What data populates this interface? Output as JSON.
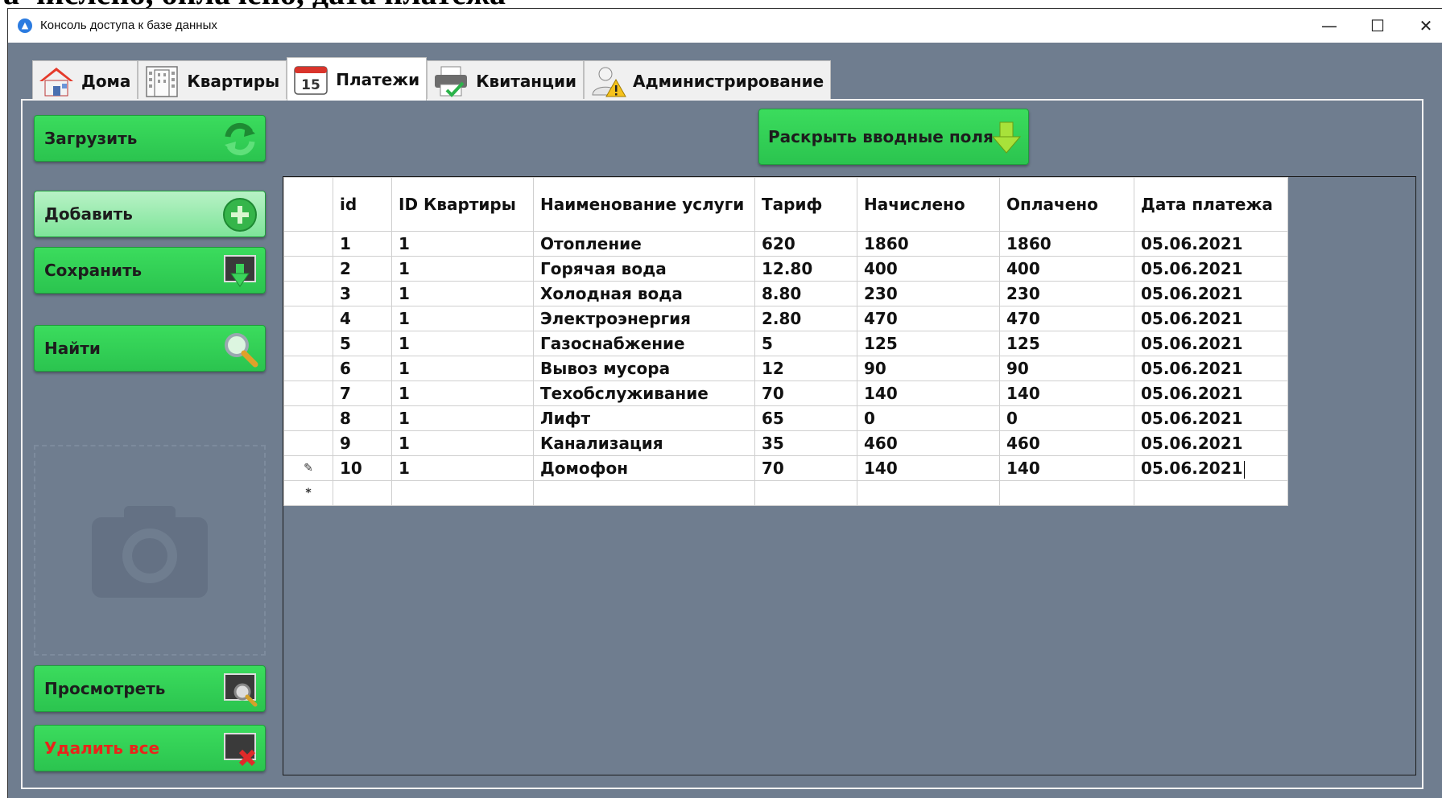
{
  "page_header_fragment": "а числено, оплачено, дата платежа",
  "window": {
    "title": "Консоль доступа к базе данных",
    "controls": [
      "—",
      "☐",
      "✕"
    ]
  },
  "tabs": [
    {
      "label": "Дома",
      "icon": "house-icon",
      "active": false
    },
    {
      "label": "Квартиры",
      "icon": "building-icon",
      "active": false
    },
    {
      "label": "Платежи",
      "icon": "calendar-icon",
      "icon_text": "15",
      "active": true
    },
    {
      "label": "Квитанции",
      "icon": "printer-icon",
      "active": false
    },
    {
      "label": "Администрирование",
      "icon": "admin-warning-icon",
      "active": false
    }
  ],
  "buttons": {
    "load": "Загрузить",
    "expand": "Раскрыть вводные поля",
    "add": "Добавить",
    "save": "Сохранить",
    "find": "Найти",
    "view": "Просмотреть",
    "delete_all": "Удалить все"
  },
  "colors": {
    "button_green": "#2fcf52",
    "delete_text": "#e8251b",
    "panel_bg": "#6f7d8f"
  },
  "table": {
    "columns": [
      "id",
      "ID Квартиры",
      "Наименование услуги",
      "Тариф",
      "Начислено",
      "Оплачено",
      "Дата платежа"
    ],
    "rows": [
      [
        "1",
        "1",
        "Отопление",
        "620",
        "1860",
        "1860",
        "05.06.2021"
      ],
      [
        "2",
        "1",
        "Горячая вода",
        "12.80",
        "400",
        "400",
        "05.06.2021"
      ],
      [
        "3",
        "1",
        "Холодная вода",
        "8.80",
        "230",
        "230",
        "05.06.2021"
      ],
      [
        "4",
        "1",
        "Электроэнергия",
        "2.80",
        "470",
        "470",
        "05.06.2021"
      ],
      [
        "5",
        "1",
        "Газоснабжение",
        "5",
        "125",
        "125",
        "05.06.2021"
      ],
      [
        "6",
        "1",
        "Вывоз мусора",
        "12",
        "90",
        "90",
        "05.06.2021"
      ],
      [
        "7",
        "1",
        "Техобслуживание",
        "70",
        "140",
        "140",
        "05.06.2021"
      ],
      [
        "8",
        "1",
        "Лифт",
        "65",
        "0",
        "0",
        "05.06.2021"
      ],
      [
        "9",
        "1",
        "Канализация",
        "35",
        "460",
        "460",
        "05.06.2021"
      ],
      [
        "10",
        "1",
        "Домофон",
        "70",
        "140",
        "140",
        "05.06.2021"
      ]
    ],
    "editing_row_marker": "✎",
    "new_row_marker": "*"
  }
}
